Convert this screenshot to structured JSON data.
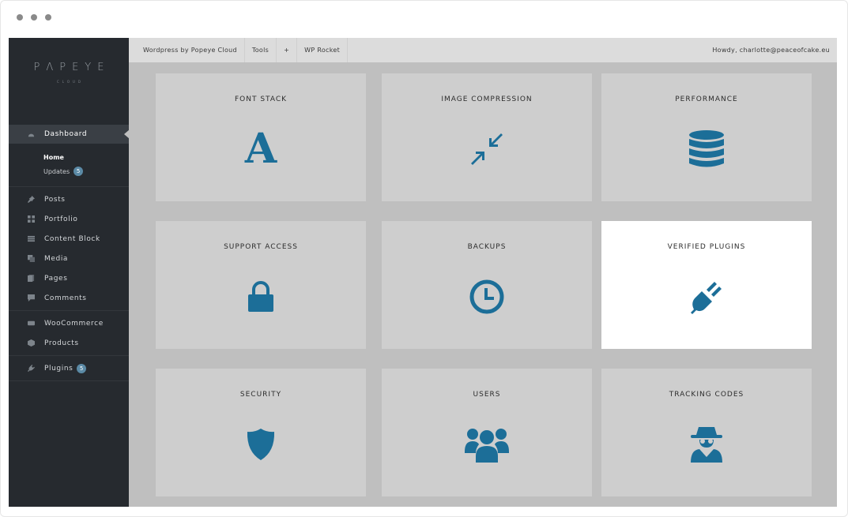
{
  "window": {
    "controls": [
      "dot",
      "dot",
      "dot"
    ]
  },
  "brand": {
    "logo_main": "PΛPEYE",
    "logo_sub": "CLOUD"
  },
  "sidebar": {
    "dashboard": {
      "label": "Dashboard",
      "icon": "gauge-icon"
    },
    "submenu": [
      {
        "label": "Home"
      },
      {
        "label": "Updates",
        "badge": "5"
      }
    ],
    "group1": [
      {
        "label": "Posts",
        "icon": "pin-icon"
      },
      {
        "label": "Portfolio",
        "icon": "grid-icon"
      },
      {
        "label": "Content Block",
        "icon": "block-icon"
      },
      {
        "label": "Media",
        "icon": "media-icon"
      },
      {
        "label": "Pages",
        "icon": "pages-icon"
      },
      {
        "label": "Comments",
        "icon": "comment-icon"
      }
    ],
    "group2": [
      {
        "label": "WooCommerce",
        "icon": "woo-icon"
      },
      {
        "label": "Products",
        "icon": "box-icon"
      }
    ],
    "plugins": {
      "label": "Plugins",
      "badge": "5",
      "icon": "plug-icon"
    }
  },
  "topbar": {
    "site": "Wordpress by Popeye Cloud",
    "tools": "Tools",
    "add": "+",
    "rocket": "WP Rocket",
    "greeting": "Howdy, charlotte@peaceofcake.eu"
  },
  "colors": {
    "accent": "#1c6e98",
    "sidebar_bg": "#262a2f",
    "tile_bg": "#cecece",
    "content_bg": "#bfbfbf"
  },
  "tiles": [
    {
      "label": "FONT STACK",
      "icon": "letter-a-icon",
      "glyph": "A"
    },
    {
      "label": "IMAGE COMPRESSION",
      "icon": "compress-icon"
    },
    {
      "label": "PERFORMANCE",
      "icon": "database-icon"
    },
    {
      "label": "SUPPORT ACCESS",
      "icon": "lock-icon"
    },
    {
      "label": "BACKUPS",
      "icon": "clock-icon"
    },
    {
      "label": "VERIFIED PLUGINS",
      "icon": "plug-icon"
    },
    {
      "label": "SECURITY",
      "icon": "shield-icon"
    },
    {
      "label": "USERS",
      "icon": "users-icon"
    },
    {
      "label": "TRACKING CODES",
      "icon": "spy-icon"
    }
  ]
}
